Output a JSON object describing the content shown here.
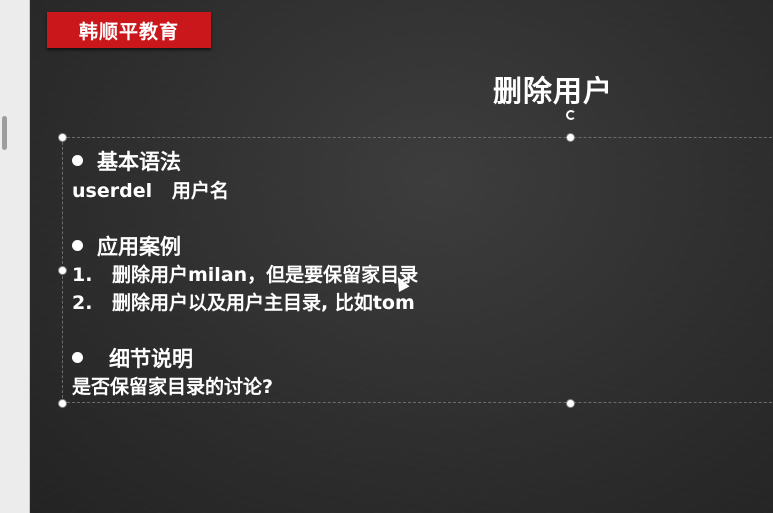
{
  "logo": {
    "text": "韩顺平教育"
  },
  "slide": {
    "title": "删除用户",
    "sections": [
      {
        "heading": "基本语法",
        "lines": [
          "userdel   用户名"
        ]
      },
      {
        "heading": "应用案例",
        "items": [
          {
            "num": "1.",
            "text": "删除用户milan，但是要保留家目录"
          },
          {
            "num": "2.",
            "text": "删除用户以及用户主目录, 比如tom"
          }
        ]
      },
      {
        "heading": "细节说明",
        "lines": [
          "是否保留家目录的讨论?"
        ]
      }
    ]
  },
  "colors": {
    "logo_bg": "#c9171c",
    "board": "#2e2e2e",
    "chalk": "#ffffff"
  }
}
